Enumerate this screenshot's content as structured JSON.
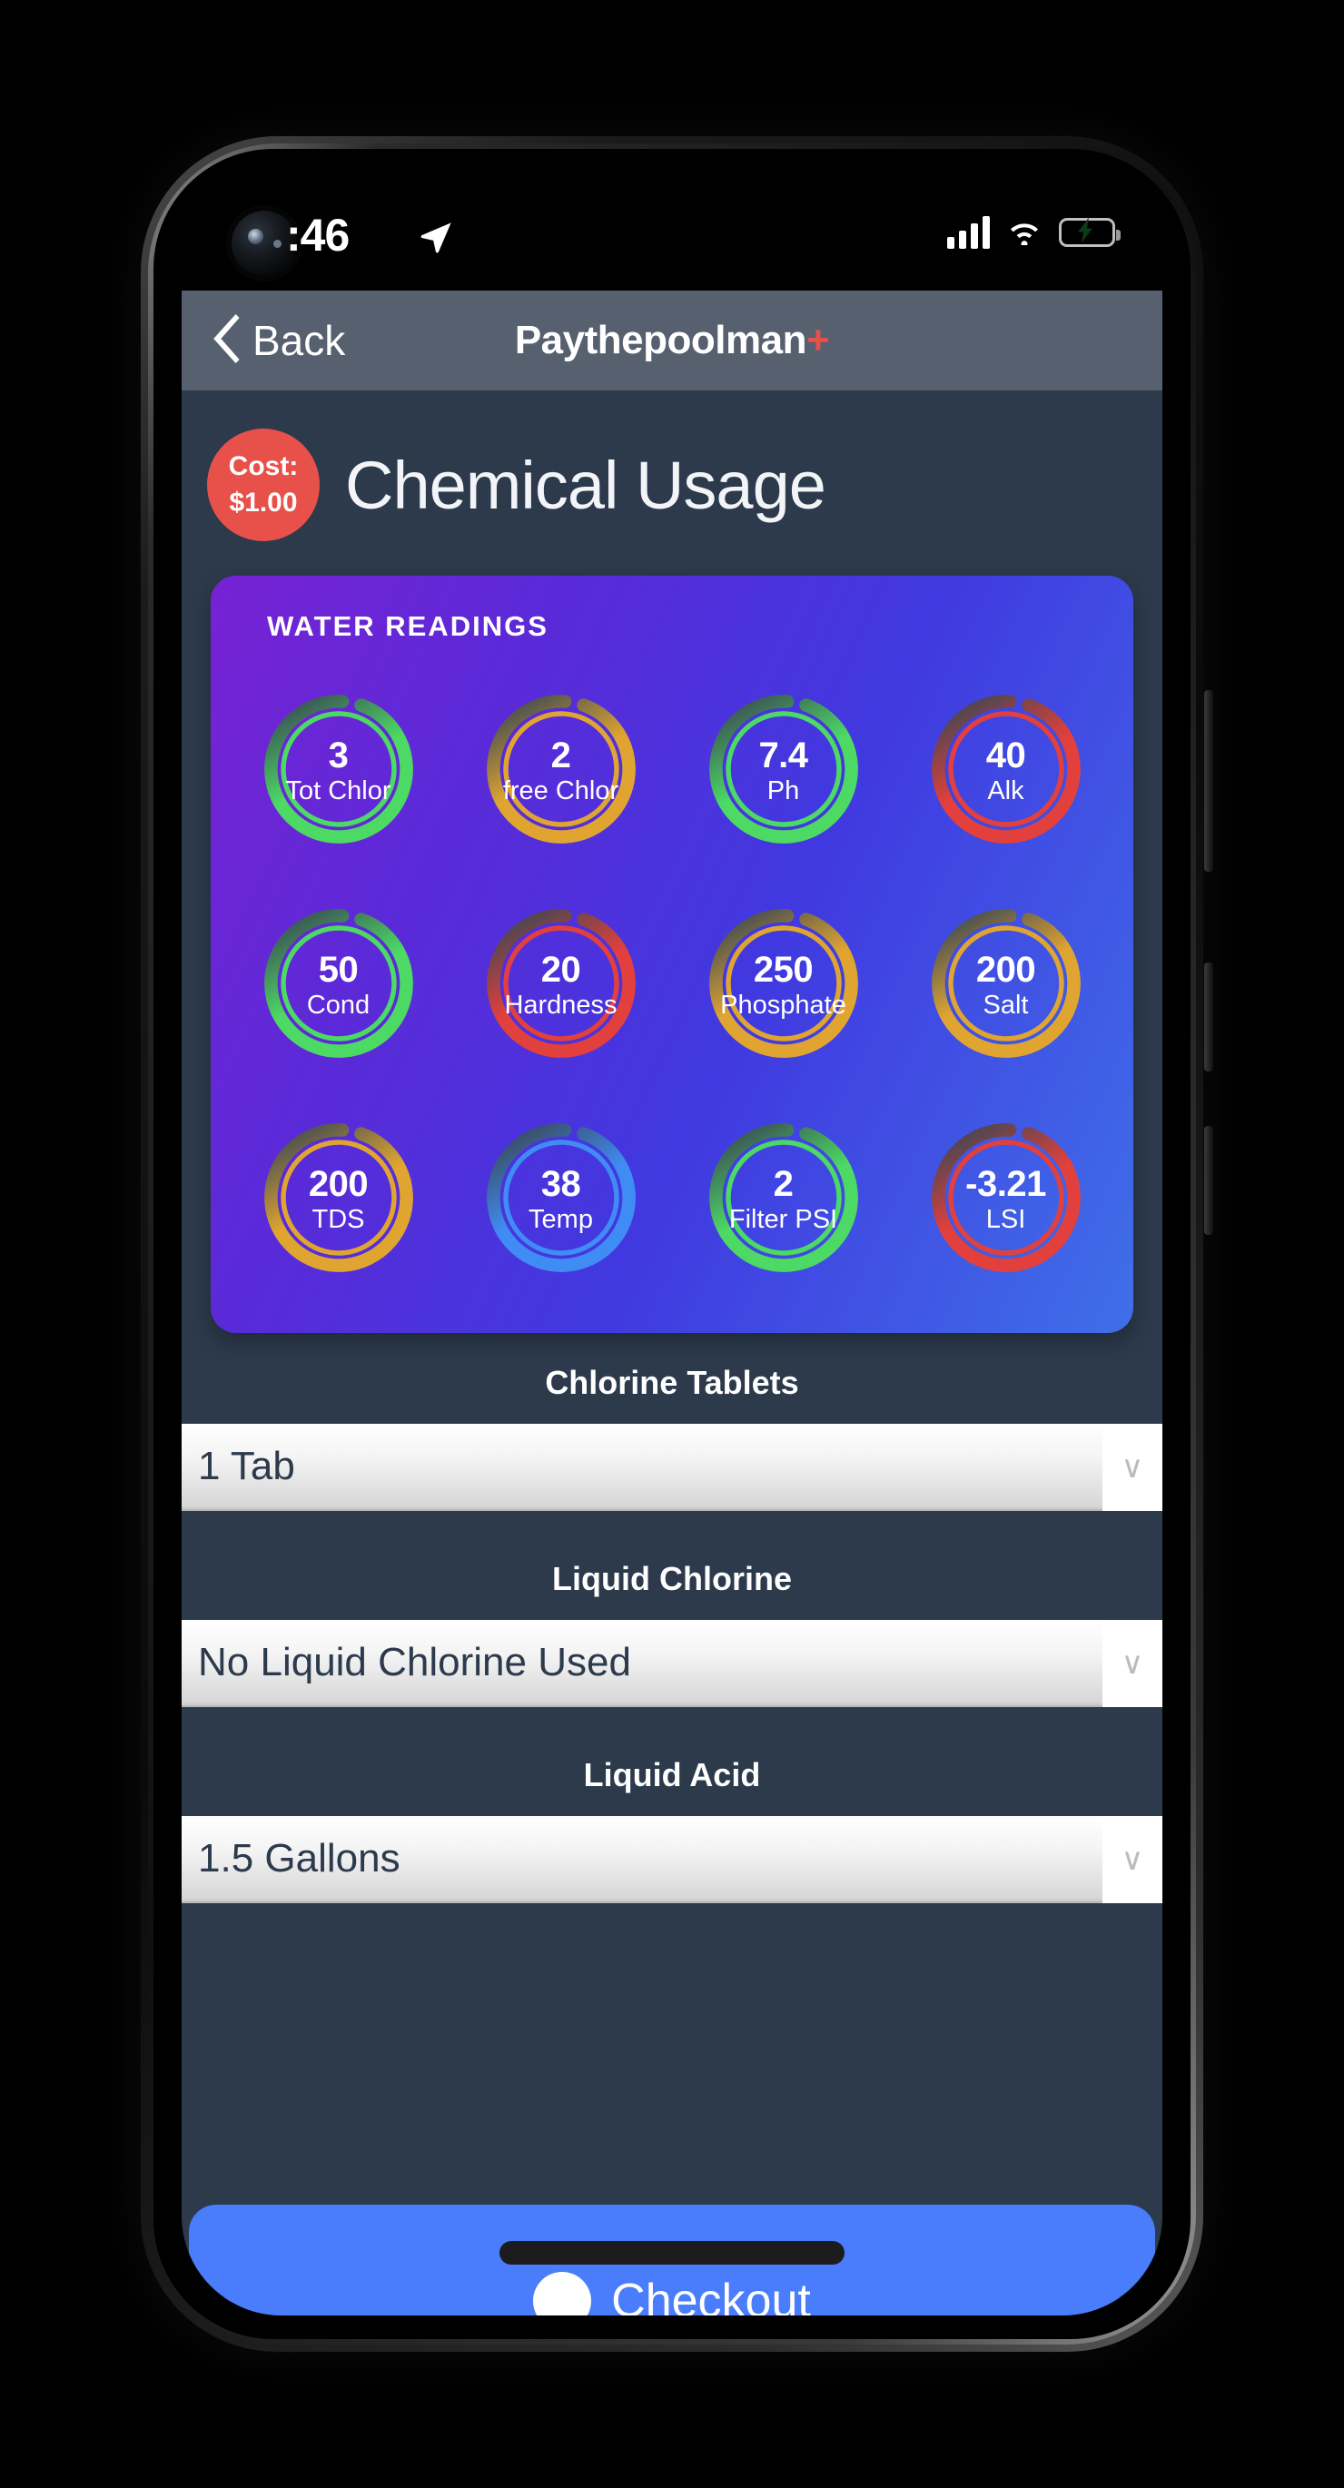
{
  "status_bar": {
    "time": ":46",
    "location_icon": "location-arrow-icon",
    "cellular_icon": "cellular-signal-icon",
    "wifi_icon": "wifi-icon",
    "battery_icon": "battery-charging-icon",
    "battery_color": "#32d74b"
  },
  "nav": {
    "back_label": "Back",
    "back_icon": "chevron-left-icon",
    "title": "Paythepoolman",
    "title_suffix": "+",
    "title_suffix_color": "#e8504a",
    "bar_color": "#56606e"
  },
  "header": {
    "cost_line1": "Cost:",
    "cost_line2": "$1.00",
    "cost_badge_color": "#e8504a",
    "title": "Chemical Usage"
  },
  "readings": {
    "section_title": "WATER READINGS",
    "card_gradient_from": "#7722d4",
    "card_gradient_to": "#3f6fe8",
    "gauges": [
      {
        "value": "3",
        "label": "Tot Chlor",
        "color": "#4cd964",
        "track": "#3a4754",
        "progress": 0.8,
        "ring_start": 0.02
      },
      {
        "value": "2",
        "label": "free Chlor",
        "color": "#e0a531",
        "track": "#3a4754",
        "progress": 0.22,
        "ring_start": 0.02
      },
      {
        "value": "7.4",
        "label": "Ph",
        "color": "#4cd964",
        "track": "#3a4754",
        "progress": 0.8,
        "ring_start": 0.02
      },
      {
        "value": "40",
        "label": "Alk",
        "color": "#e2403c",
        "track": "#3a4754",
        "progress": 0.2,
        "ring_start": 0.02
      },
      {
        "value": "50",
        "label": "Cond",
        "color": "#4cd964",
        "track": "#3a4754",
        "progress": 0.8,
        "ring_start": 0.02
      },
      {
        "value": "20",
        "label": "Hardness",
        "color": "#e2403c",
        "track": "#3a4754",
        "progress": 0.2,
        "ring_start": 0.02
      },
      {
        "value": "250",
        "label": "Phosphate",
        "color": "#e0a531",
        "track": "#3a4754",
        "progress": 0.92,
        "ring_start": 0.02
      },
      {
        "value": "200",
        "label": "Salt",
        "color": "#e0a531",
        "track": "#3a4754",
        "progress": 0.92,
        "ring_start": 0.02
      },
      {
        "value": "200",
        "label": "TDS",
        "color": "#e0a531",
        "track": "#3a4754",
        "progress": 0.22,
        "ring_start": 0.02
      },
      {
        "value": "38",
        "label": "Temp",
        "color": "#3f8cf5",
        "track": "#3a4754",
        "progress": 0.92,
        "ring_start": 0.02
      },
      {
        "value": "2",
        "label": "Filter PSI",
        "color": "#4cd964",
        "track": "#3a4754",
        "progress": 0.92,
        "ring_start": 0.02
      },
      {
        "value": "-3.21",
        "label": "LSI",
        "color": "#e2403c",
        "track": "#3a4754",
        "progress": 0.92,
        "ring_start": 0.02
      }
    ]
  },
  "fields": [
    {
      "label": "Chlorine Tablets",
      "value": "1 Tab",
      "caret_icon": "chevron-down-icon"
    },
    {
      "label": "Liquid Chlorine",
      "value": "No Liquid Chlorine Used",
      "caret_icon": "chevron-down-icon"
    },
    {
      "label": "Liquid Acid",
      "value": "1.5 Gallons",
      "caret_icon": "chevron-down-icon"
    }
  ],
  "bottom": {
    "button_label": "Checkout",
    "button_color": "#4a7dfc",
    "button_icon": "circle-icon"
  },
  "chart_data": {
    "type": "bar",
    "title": "WATER READINGS",
    "categories": [
      "Tot Chlor",
      "free Chlor",
      "Ph",
      "Alk",
      "Cond",
      "Hardness",
      "Phosphate",
      "Salt",
      "TDS",
      "Temp",
      "Filter PSI",
      "LSI"
    ],
    "values": [
      3,
      2,
      7.4,
      40,
      50,
      20,
      250,
      200,
      200,
      38,
      2,
      -3.21
    ],
    "status_colors": [
      "#4cd964",
      "#e0a531",
      "#4cd964",
      "#e2403c",
      "#4cd964",
      "#e2403c",
      "#e0a531",
      "#e0a531",
      "#e0a531",
      "#3f8cf5",
      "#4cd964",
      "#e2403c"
    ],
    "xlabel": "",
    "ylabel": "",
    "legend": "none",
    "grid": false
  }
}
